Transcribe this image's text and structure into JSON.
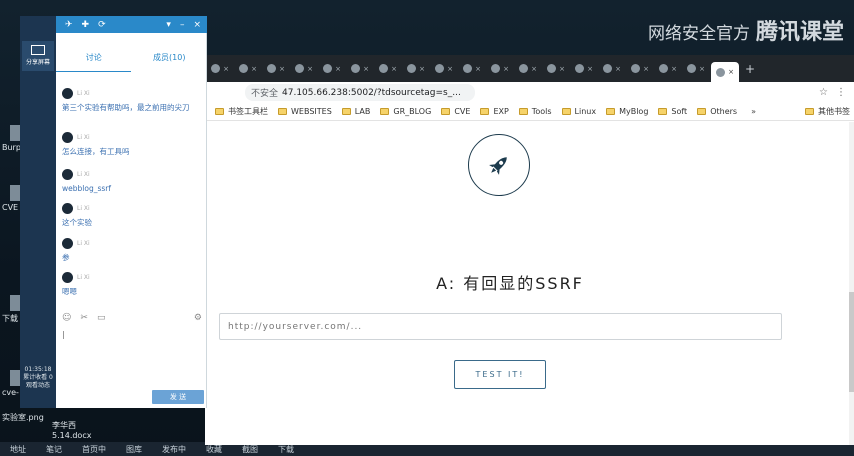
{
  "watermark": {
    "text": "网络安全官方",
    "brand": "腾讯课堂"
  },
  "desktop": {
    "icons": [
      {
        "label": "Burp"
      },
      {
        "label": "CVE"
      },
      {
        "label": "下载"
      },
      {
        "label": "cve-"
      },
      {
        "label": "实验室.png"
      },
      {
        "label": "李华西 5.14.docx"
      }
    ]
  },
  "taskbar": {
    "items": [
      "地址",
      "笔记",
      "首页中",
      "图库",
      "发布中",
      "收藏",
      "截图",
      "下载"
    ]
  },
  "leftbar": {
    "share_label": "分享屏幕",
    "time": "01:35:18",
    "status": "累计收看 0 观看动态"
  },
  "chat": {
    "tabs": [
      "讨论",
      "成员(10)"
    ],
    "messages": [
      {
        "user": "Li Xi",
        "text": "第三个实验有帮助吗，最之前用的尖刀"
      },
      {
        "user": "Li Xi",
        "text": "怎么连接，有工具吗"
      },
      {
        "user": "Li Xi",
        "text": "webblog_ssrf"
      },
      {
        "user": "Li Xi",
        "text": "这个实验"
      },
      {
        "user": "Li Xi",
        "text": "参"
      },
      {
        "user": "Li Xi",
        "text": "嗯嗯"
      }
    ],
    "input_caret": "|",
    "send_label": "发 送"
  },
  "browser": {
    "active_tab_close": "×",
    "new_tab": "+",
    "omnibox": {
      "warning": "不安全",
      "url": "47.105.66.238:5002/?tdsourcetag=s_..."
    },
    "bookmarks": [
      {
        "label": "书签工具栏"
      },
      {
        "label": "WEBSITES"
      },
      {
        "label": "LAB"
      },
      {
        "label": "GR_BLOG"
      },
      {
        "label": "CVE"
      },
      {
        "label": "EXP"
      },
      {
        "label": "Tools"
      },
      {
        "label": "Linux"
      },
      {
        "label": "MyBlog"
      },
      {
        "label": "Soft"
      },
      {
        "label": "Others"
      }
    ],
    "bookmarks_more": "»",
    "other_bookmarks": "其他书签"
  },
  "page": {
    "heading": "A: 有回显的SSRF",
    "input_placeholder": "http://yourserver.com/...",
    "button_label": "TEST IT!"
  }
}
